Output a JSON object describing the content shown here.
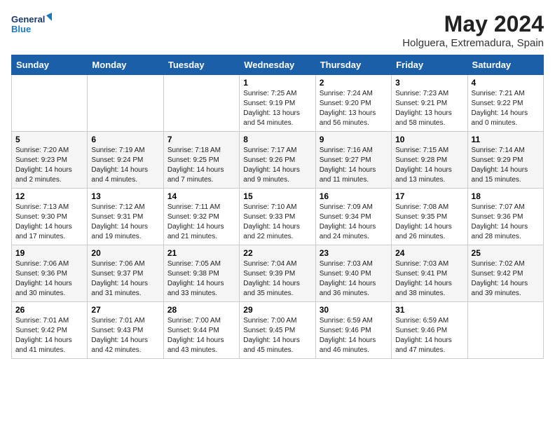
{
  "header": {
    "logo_line1": "General",
    "logo_line2": "Blue",
    "month_year": "May 2024",
    "location": "Holguera, Extremadura, Spain"
  },
  "weekdays": [
    "Sunday",
    "Monday",
    "Tuesday",
    "Wednesday",
    "Thursday",
    "Friday",
    "Saturday"
  ],
  "weeks": [
    [
      {
        "day": "",
        "info": ""
      },
      {
        "day": "",
        "info": ""
      },
      {
        "day": "",
        "info": ""
      },
      {
        "day": "1",
        "info": "Sunrise: 7:25 AM\nSunset: 9:19 PM\nDaylight: 13 hours\nand 54 minutes."
      },
      {
        "day": "2",
        "info": "Sunrise: 7:24 AM\nSunset: 9:20 PM\nDaylight: 13 hours\nand 56 minutes."
      },
      {
        "day": "3",
        "info": "Sunrise: 7:23 AM\nSunset: 9:21 PM\nDaylight: 13 hours\nand 58 minutes."
      },
      {
        "day": "4",
        "info": "Sunrise: 7:21 AM\nSunset: 9:22 PM\nDaylight: 14 hours\nand 0 minutes."
      }
    ],
    [
      {
        "day": "5",
        "info": "Sunrise: 7:20 AM\nSunset: 9:23 PM\nDaylight: 14 hours\nand 2 minutes."
      },
      {
        "day": "6",
        "info": "Sunrise: 7:19 AM\nSunset: 9:24 PM\nDaylight: 14 hours\nand 4 minutes."
      },
      {
        "day": "7",
        "info": "Sunrise: 7:18 AM\nSunset: 9:25 PM\nDaylight: 14 hours\nand 7 minutes."
      },
      {
        "day": "8",
        "info": "Sunrise: 7:17 AM\nSunset: 9:26 PM\nDaylight: 14 hours\nand 9 minutes."
      },
      {
        "day": "9",
        "info": "Sunrise: 7:16 AM\nSunset: 9:27 PM\nDaylight: 14 hours\nand 11 minutes."
      },
      {
        "day": "10",
        "info": "Sunrise: 7:15 AM\nSunset: 9:28 PM\nDaylight: 14 hours\nand 13 minutes."
      },
      {
        "day": "11",
        "info": "Sunrise: 7:14 AM\nSunset: 9:29 PM\nDaylight: 14 hours\nand 15 minutes."
      }
    ],
    [
      {
        "day": "12",
        "info": "Sunrise: 7:13 AM\nSunset: 9:30 PM\nDaylight: 14 hours\nand 17 minutes."
      },
      {
        "day": "13",
        "info": "Sunrise: 7:12 AM\nSunset: 9:31 PM\nDaylight: 14 hours\nand 19 minutes."
      },
      {
        "day": "14",
        "info": "Sunrise: 7:11 AM\nSunset: 9:32 PM\nDaylight: 14 hours\nand 21 minutes."
      },
      {
        "day": "15",
        "info": "Sunrise: 7:10 AM\nSunset: 9:33 PM\nDaylight: 14 hours\nand 22 minutes."
      },
      {
        "day": "16",
        "info": "Sunrise: 7:09 AM\nSunset: 9:34 PM\nDaylight: 14 hours\nand 24 minutes."
      },
      {
        "day": "17",
        "info": "Sunrise: 7:08 AM\nSunset: 9:35 PM\nDaylight: 14 hours\nand 26 minutes."
      },
      {
        "day": "18",
        "info": "Sunrise: 7:07 AM\nSunset: 9:36 PM\nDaylight: 14 hours\nand 28 minutes."
      }
    ],
    [
      {
        "day": "19",
        "info": "Sunrise: 7:06 AM\nSunset: 9:36 PM\nDaylight: 14 hours\nand 30 minutes."
      },
      {
        "day": "20",
        "info": "Sunrise: 7:06 AM\nSunset: 9:37 PM\nDaylight: 14 hours\nand 31 minutes."
      },
      {
        "day": "21",
        "info": "Sunrise: 7:05 AM\nSunset: 9:38 PM\nDaylight: 14 hours\nand 33 minutes."
      },
      {
        "day": "22",
        "info": "Sunrise: 7:04 AM\nSunset: 9:39 PM\nDaylight: 14 hours\nand 35 minutes."
      },
      {
        "day": "23",
        "info": "Sunrise: 7:03 AM\nSunset: 9:40 PM\nDaylight: 14 hours\nand 36 minutes."
      },
      {
        "day": "24",
        "info": "Sunrise: 7:03 AM\nSunset: 9:41 PM\nDaylight: 14 hours\nand 38 minutes."
      },
      {
        "day": "25",
        "info": "Sunrise: 7:02 AM\nSunset: 9:42 PM\nDaylight: 14 hours\nand 39 minutes."
      }
    ],
    [
      {
        "day": "26",
        "info": "Sunrise: 7:01 AM\nSunset: 9:42 PM\nDaylight: 14 hours\nand 41 minutes."
      },
      {
        "day": "27",
        "info": "Sunrise: 7:01 AM\nSunset: 9:43 PM\nDaylight: 14 hours\nand 42 minutes."
      },
      {
        "day": "28",
        "info": "Sunrise: 7:00 AM\nSunset: 9:44 PM\nDaylight: 14 hours\nand 43 minutes."
      },
      {
        "day": "29",
        "info": "Sunrise: 7:00 AM\nSunset: 9:45 PM\nDaylight: 14 hours\nand 45 minutes."
      },
      {
        "day": "30",
        "info": "Sunrise: 6:59 AM\nSunset: 9:46 PM\nDaylight: 14 hours\nand 46 minutes."
      },
      {
        "day": "31",
        "info": "Sunrise: 6:59 AM\nSunset: 9:46 PM\nDaylight: 14 hours\nand 47 minutes."
      },
      {
        "day": "",
        "info": ""
      }
    ]
  ]
}
